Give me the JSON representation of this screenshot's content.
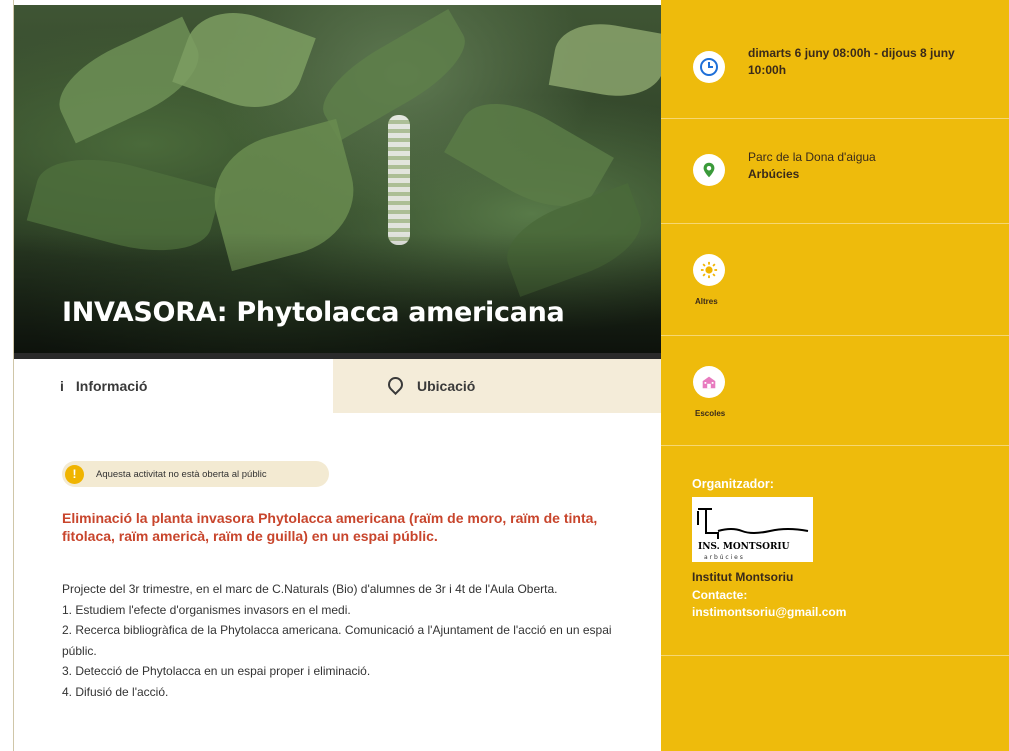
{
  "hero": {
    "title": "INVASORA: Phytolacca americana"
  },
  "tabs": [
    {
      "label": "Informació",
      "icon": "info-icon"
    },
    {
      "label": "Ubicació",
      "icon": "map-pin-icon"
    }
  ],
  "notice": {
    "text": "Aquesta activitat no està oberta al públic"
  },
  "content": {
    "lead": "Eliminació la planta invasora Phytolacca americana (raïm de moro, raïm de tinta, fitolaca, raïm americà, raïm de guilla) en un espai públic.",
    "paragraphs": [
      "Projecte del 3r trimestre, en el marc de C.Naturals (Bio) d'alumnes de 3r i 4t de l'Aula Oberta.",
      "1. Estudiem l'efecte d'organismes invasors en el medi.",
      "2. Recerca bibliogràfica de la Phytolacca americana. Comunicació a l'Ajuntament de l'acció en un espai públic.",
      "3. Detecció de Phytolacca en un espai proper i eliminació.",
      "4. Difusió de l'acció."
    ]
  },
  "sidebar": {
    "date": {
      "text": "dimarts 6 juny 08:00h - dijous 8 juny 10:00h",
      "icon": "clock-icon"
    },
    "location": {
      "place": "Parc de la Dona d'aigua",
      "town": "Arbúcies",
      "icon": "map-pin-icon"
    },
    "category1": {
      "label": "Altres",
      "icon": "sun-icon"
    },
    "category2": {
      "label": "Escoles",
      "icon": "school-icon"
    },
    "organizer": {
      "label": "Organitzador:",
      "logo_line1": "INS. MONTSORIU",
      "logo_line2": "a r b ú c i e s",
      "name": "Institut Montsoriu",
      "contact_label": "Contacte:",
      "email": "instimontsoriu@gmail.com"
    }
  },
  "colors": {
    "sidebar_bg": "#eebb0c",
    "lead_text": "#c8452c",
    "tab_inactive_bg": "#f4ecd9"
  }
}
